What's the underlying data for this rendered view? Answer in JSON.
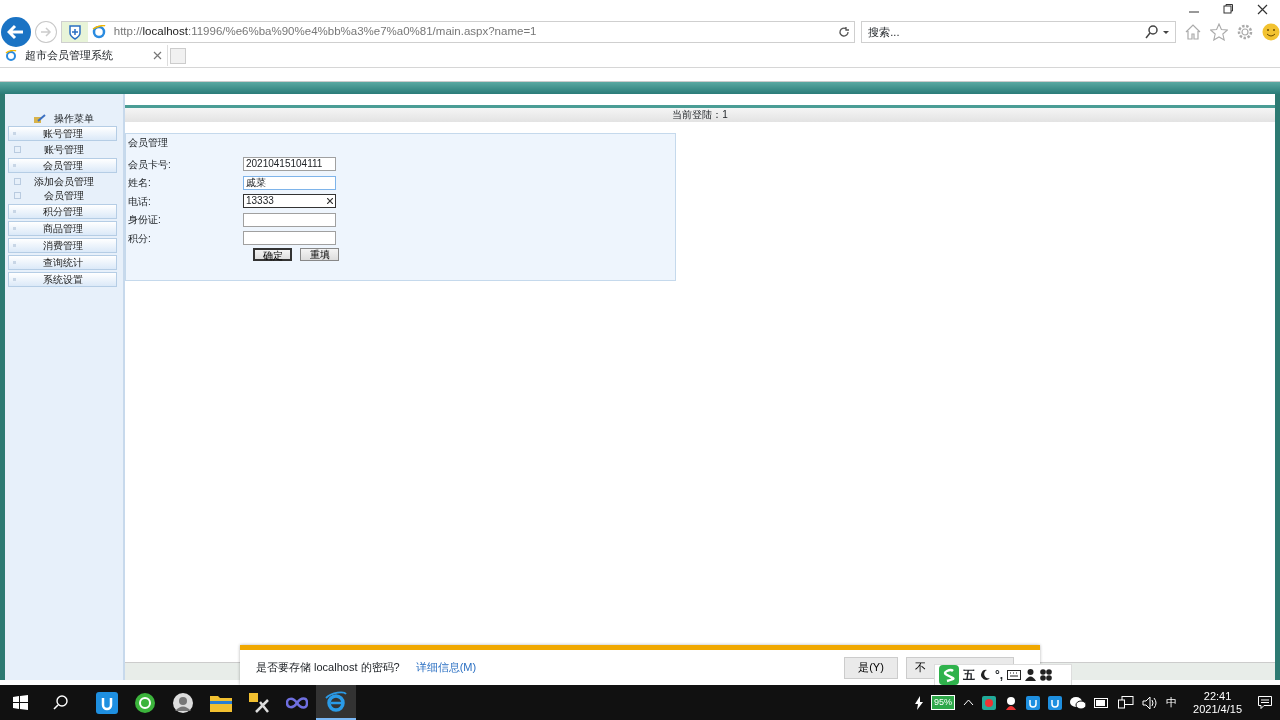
{
  "browser": {
    "url": "http://**localhost**:11996/%e6%ba%90%e4%bb%a3%e7%a0%81/main.aspx?name=1",
    "search_placeholder": "搜索...",
    "tab_title": "超市会员管理系统"
  },
  "page": {
    "login_status": "当前登陆：1",
    "menu_title": "操作菜单",
    "sidebar": {
      "items": [
        {
          "kind": "section",
          "label": "账号管理"
        },
        {
          "kind": "sub",
          "label": "账号管理"
        },
        {
          "kind": "section",
          "label": "会员管理"
        },
        {
          "kind": "sub",
          "label": "添加会员管理"
        },
        {
          "kind": "sub",
          "label": "会员管理"
        },
        {
          "kind": "section",
          "label": "积分管理"
        },
        {
          "kind": "section",
          "label": "商品管理"
        },
        {
          "kind": "section",
          "label": "消费管理"
        },
        {
          "kind": "section",
          "label": "查询统计"
        },
        {
          "kind": "section",
          "label": "系统设置"
        }
      ]
    },
    "form": {
      "title": "会员管理",
      "fields": [
        {
          "label": "会员卡号:",
          "value": "20210415104111",
          "hovered": false,
          "focused": false
        },
        {
          "label": "姓名:",
          "value": "戚菜",
          "hovered": true,
          "focused": false
        },
        {
          "label": "电话:",
          "value": "13333",
          "hovered": false,
          "focused": true
        },
        {
          "label": "身份证:",
          "hovered": false,
          "focused": false
        },
        {
          "label": "积分:",
          "hovered": false,
          "focused": false
        }
      ],
      "buttons": [
        {
          "label": "确定",
          "default": true
        },
        {
          "label": "重填",
          "default": false
        }
      ]
    }
  },
  "notification": {
    "message": "是否要存储 localhost 的密码?",
    "link": "详细信息(M)",
    "buttons": [
      "是(Y)",
      "不"
    ]
  },
  "ime": {
    "mode": "五",
    "punctuation": "°,"
  },
  "taskbar": {
    "battery": "95%",
    "input_mode": "中",
    "time": "22:41",
    "date": "2021/4/15"
  }
}
